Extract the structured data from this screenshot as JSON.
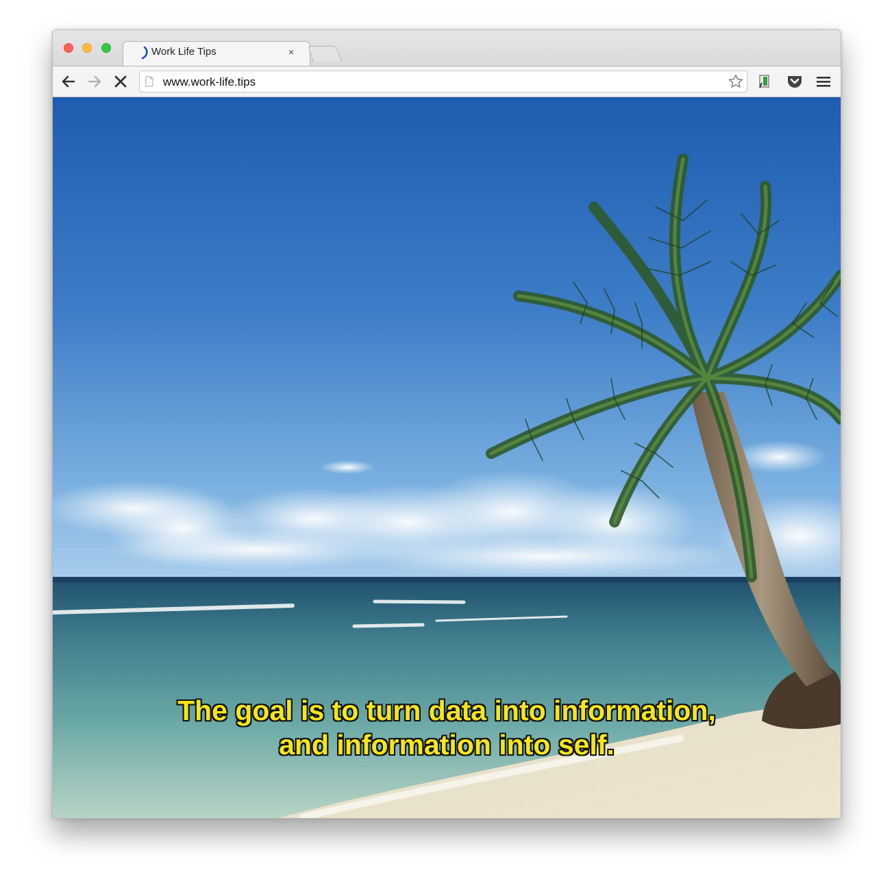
{
  "browser": {
    "tab": {
      "title": "Work Life Tips",
      "close_glyph": "×",
      "favicon": "work-life-tips-logo"
    },
    "toolbar": {
      "back_icon": "back-arrow-icon",
      "forward_icon": "forward-arrow-icon",
      "stop_icon": "stop-loading-icon",
      "url": "www.work-life.tips",
      "bookmark_icon": "star-icon",
      "extension_icon": "extension-icon",
      "pocket_icon": "pocket-icon",
      "menu_icon": "hamburger-menu-icon"
    }
  },
  "video": {
    "scene": "tropical beach with palm tree",
    "subtitle_line1": "The goal is to turn data into information,",
    "subtitle_line2": "and information into self.",
    "subtitle_color": "#f4e61a"
  }
}
